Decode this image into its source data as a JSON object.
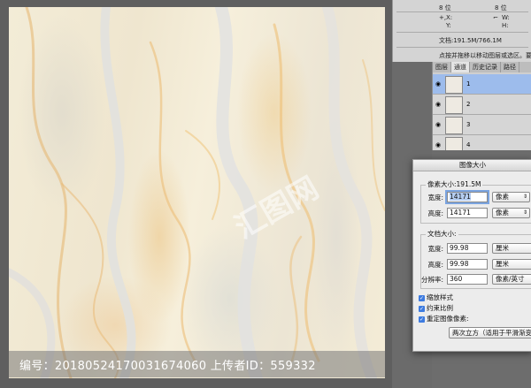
{
  "info": {
    "bits_left": "8 位",
    "bits_right": "8 位",
    "x_label": "X:",
    "y_label": "Y:",
    "w_label": "W:",
    "h_label": "H:",
    "doc_size": "文档:191.5M/766.1M",
    "hint": "点按并拖移以移动图层或选区。要用附加"
  },
  "layers_panel": {
    "tabs": [
      "图层",
      "通道",
      "历史记录",
      "路径"
    ],
    "active_tab": 1,
    "layers": [
      {
        "name": "1",
        "selected": true
      },
      {
        "name": "2",
        "selected": false
      },
      {
        "name": "3",
        "selected": false
      },
      {
        "name": "4",
        "selected": false
      }
    ]
  },
  "dialog": {
    "title": "图像大小",
    "pixel_dims_label": "像素大小:191.5M",
    "width_label": "宽度:",
    "width_value": "14171",
    "width_unit": "像素",
    "height_label": "高度:",
    "height_value": "14171",
    "height_unit": "像素",
    "doc_size_label": "文档大小:",
    "doc_width_label": "宽度:",
    "doc_width_value": "99.98",
    "doc_width_unit": "厘米",
    "doc_height_label": "高度:",
    "doc_height_value": "99.98",
    "doc_height_unit": "厘米",
    "resolution_label": "分辨率:",
    "resolution_value": "360",
    "resolution_unit": "像素/英寸",
    "scale_styles": "缩放样式",
    "constrain": "约束比例",
    "resample": "重定图像像素:",
    "resample_method": "两次立方（适用于平滑渐变"
  },
  "watermark": {
    "text": "编号：20180524170031674060 上传者ID：559332",
    "logo": "汇图网"
  }
}
